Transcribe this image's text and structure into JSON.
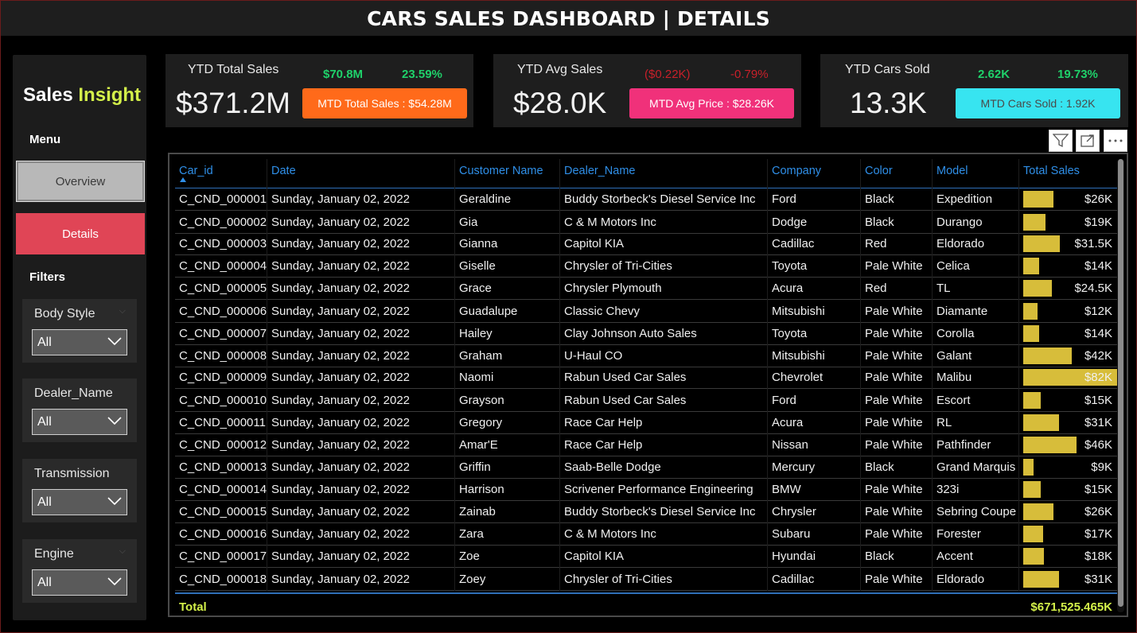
{
  "title": "CARS SALES DASHBOARD | DETAILS",
  "brand": {
    "part1": "Sales",
    "part2": "Insight"
  },
  "sidebar": {
    "menu_heading": "Menu",
    "overview_label": "Overview",
    "details_label": "Details",
    "filters_heading": "Filters",
    "slicers": [
      {
        "label": "Body Style",
        "value": "All"
      },
      {
        "label": "Dealer_Name",
        "value": "All"
      },
      {
        "label": "Transmission",
        "value": "All"
      },
      {
        "label": "Engine",
        "value": "All"
      }
    ]
  },
  "kpis": [
    {
      "label": "YTD Total Sales",
      "value": "$371.2M",
      "delta1": "$70.8M",
      "delta2": "23.59%",
      "button": "MTD Total Sales : $54.28M",
      "delta_color": "#1fd16a",
      "button_color": "#ff6a1a",
      "button_text_color": "#ffffff"
    },
    {
      "label": "YTD Avg Sales",
      "value": "$28.0K",
      "delta1": "($0.22K)",
      "delta2": "-0.79%",
      "button": "MTD Avg Price : $28.26K",
      "delta_color": "#c8202a",
      "button_color": "#f0317a",
      "button_text_color": "#ffffff"
    },
    {
      "label": "YTD Cars Sold",
      "value": "13.3K",
      "delta1": "2.62K",
      "delta2": "19.73%",
      "button": "MTD Cars Sold : 1.92K",
      "delta_color": "#1fd16a",
      "button_color": "#37e4f0",
      "button_text_color": "#4a4a4a"
    }
  ],
  "table": {
    "columns": [
      "Car_id",
      "Date",
      "Customer Name",
      "Dealer_Name",
      "Company",
      "Color",
      "Model",
      "Total Sales"
    ],
    "rows": [
      {
        "car_id": "C_CND_000001",
        "date": "Sunday, January 02, 2022",
        "customer": "Geraldine",
        "dealer": "Buddy Storbeck's Diesel Service Inc",
        "company": "Ford",
        "color": "Black",
        "model": "Expedition",
        "sales": "$26K",
        "value": 26
      },
      {
        "car_id": "C_CND_000002",
        "date": "Sunday, January 02, 2022",
        "customer": "Gia",
        "dealer": "C & M Motors Inc",
        "company": "Dodge",
        "color": "Black",
        "model": "Durango",
        "sales": "$19K",
        "value": 19
      },
      {
        "car_id": "C_CND_000003",
        "date": "Sunday, January 02, 2022",
        "customer": "Gianna",
        "dealer": "Capitol KIA",
        "company": "Cadillac",
        "color": "Red",
        "model": "Eldorado",
        "sales": "$31.5K",
        "value": 31.5
      },
      {
        "car_id": "C_CND_000004",
        "date": "Sunday, January 02, 2022",
        "customer": "Giselle",
        "dealer": "Chrysler of Tri-Cities",
        "company": "Toyota",
        "color": "Pale White",
        "model": "Celica",
        "sales": "$14K",
        "value": 14
      },
      {
        "car_id": "C_CND_000005",
        "date": "Sunday, January 02, 2022",
        "customer": "Grace",
        "dealer": "Chrysler Plymouth",
        "company": "Acura",
        "color": "Red",
        "model": "TL",
        "sales": "$24.5K",
        "value": 24.5
      },
      {
        "car_id": "C_CND_000006",
        "date": "Sunday, January 02, 2022",
        "customer": "Guadalupe",
        "dealer": "Classic Chevy",
        "company": "Mitsubishi",
        "color": "Pale White",
        "model": "Diamante",
        "sales": "$12K",
        "value": 12
      },
      {
        "car_id": "C_CND_000007",
        "date": "Sunday, January 02, 2022",
        "customer": "Hailey",
        "dealer": "Clay Johnson Auto Sales",
        "company": "Toyota",
        "color": "Pale White",
        "model": "Corolla",
        "sales": "$14K",
        "value": 14
      },
      {
        "car_id": "C_CND_000008",
        "date": "Sunday, January 02, 2022",
        "customer": "Graham",
        "dealer": "U-Haul CO",
        "company": "Mitsubishi",
        "color": "Pale White",
        "model": "Galant",
        "sales": "$42K",
        "value": 42
      },
      {
        "car_id": "C_CND_000009",
        "date": "Sunday, January 02, 2022",
        "customer": "Naomi",
        "dealer": "Rabun Used Car Sales",
        "company": "Chevrolet",
        "color": "Pale White",
        "model": "Malibu",
        "sales": "$82K",
        "value": 82
      },
      {
        "car_id": "C_CND_000010",
        "date": "Sunday, January 02, 2022",
        "customer": "Grayson",
        "dealer": "Rabun Used Car Sales",
        "company": "Ford",
        "color": "Pale White",
        "model": "Escort",
        "sales": "$15K",
        "value": 15
      },
      {
        "car_id": "C_CND_000011",
        "date": "Sunday, January 02, 2022",
        "customer": "Gregory",
        "dealer": "Race Car Help",
        "company": "Acura",
        "color": "Pale White",
        "model": "RL",
        "sales": "$31K",
        "value": 31
      },
      {
        "car_id": "C_CND_000012",
        "date": "Sunday, January 02, 2022",
        "customer": "Amar'E",
        "dealer": "Race Car Help",
        "company": "Nissan",
        "color": "Pale White",
        "model": "Pathfinder",
        "sales": "$46K",
        "value": 46
      },
      {
        "car_id": "C_CND_000013",
        "date": "Sunday, January 02, 2022",
        "customer": "Griffin",
        "dealer": "Saab-Belle Dodge",
        "company": "Mercury",
        "color": "Black",
        "model": "Grand Marquis",
        "sales": "$9K",
        "value": 9
      },
      {
        "car_id": "C_CND_000014",
        "date": "Sunday, January 02, 2022",
        "customer": "Harrison",
        "dealer": "Scrivener Performance Engineering",
        "company": "BMW",
        "color": "Pale White",
        "model": "323i",
        "sales": "$15K",
        "value": 15
      },
      {
        "car_id": "C_CND_000015",
        "date": "Sunday, January 02, 2022",
        "customer": "Zainab",
        "dealer": "Buddy Storbeck's Diesel Service Inc",
        "company": "Chrysler",
        "color": "Pale White",
        "model": "Sebring Coupe",
        "sales": "$26K",
        "value": 26
      },
      {
        "car_id": "C_CND_000016",
        "date": "Sunday, January 02, 2022",
        "customer": "Zara",
        "dealer": "C & M Motors Inc",
        "company": "Subaru",
        "color": "Pale White",
        "model": "Forester",
        "sales": "$17K",
        "value": 17
      },
      {
        "car_id": "C_CND_000017",
        "date": "Sunday, January 02, 2022",
        "customer": "Zoe",
        "dealer": "Capitol KIA",
        "company": "Hyundai",
        "color": "Black",
        "model": "Accent",
        "sales": "$18K",
        "value": 18
      },
      {
        "car_id": "C_CND_000018",
        "date": "Sunday, January 02, 2022",
        "customer": "Zoey",
        "dealer": "Chrysler of Tri-Cities",
        "company": "Cadillac",
        "color": "Pale White",
        "model": "Eldorado",
        "sales": "$31K",
        "value": 31
      }
    ],
    "total_label": "Total",
    "total_value": "$671,525.465K",
    "bar_max": 82,
    "bar_color": "#d7bd3a",
    "total_color": "#d4f14a",
    "header_color": "#2f8fe8"
  },
  "visual_header_icons": [
    "filter-icon",
    "focus-mode-icon",
    "more-options-icon"
  ]
}
